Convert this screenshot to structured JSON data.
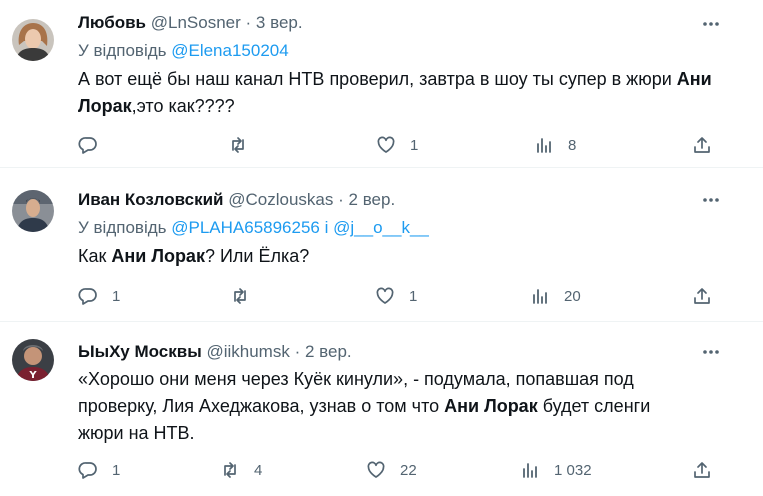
{
  "tweets": [
    {
      "name": "Любовь",
      "handle": "@LnSosner",
      "dot": "·",
      "time": "3 вер.",
      "reply_prefix": "У відповідь",
      "reply_mentions": [
        "@Elena150204"
      ],
      "reply_sep": "",
      "text_parts": [
        "А вот ещё бы наш канал НТВ проверил, завтра в шоу ты супер в жюри ",
        "Ани Лорак",
        ",это как????"
      ],
      "stats": {
        "replies": "",
        "retweets": "",
        "likes": "1",
        "views": "8"
      }
    },
    {
      "name": "Иван Козловский",
      "handle": "@Cozlouskas",
      "dot": "·",
      "time": "2 вер.",
      "reply_prefix": "У відповідь",
      "reply_mentions": [
        "@PLAHA65896256",
        "@j__o__k__"
      ],
      "reply_sep": "і",
      "text_parts": [
        "Как ",
        "Ани Лорак",
        "? Или Ёлка?"
      ],
      "stats": {
        "replies": "1",
        "retweets": "",
        "likes": "1",
        "views": "20"
      }
    },
    {
      "name": "ЫыХу Москвы",
      "handle": "@iikhumsk",
      "dot": "·",
      "time": "2 вер.",
      "text_parts": [
        "«Хорошо они меня через Куёк кинули», - подумала, попавшая под проверку, Лия Ахеджакова, узнав о том что ",
        "Ани Лорак",
        " будет сленги жюри на НТВ."
      ],
      "stats": {
        "replies": "1",
        "retweets": "4",
        "likes": "22",
        "views": "1 032"
      }
    }
  ],
  "colors": {
    "text": "#0f1419",
    "muted": "#536471",
    "accent": "#1d9bf0",
    "divider": "#eff3f4"
  },
  "icons": [
    "more-icon",
    "reply-icon",
    "retweet-icon",
    "like-icon",
    "views-icon",
    "share-icon"
  ]
}
